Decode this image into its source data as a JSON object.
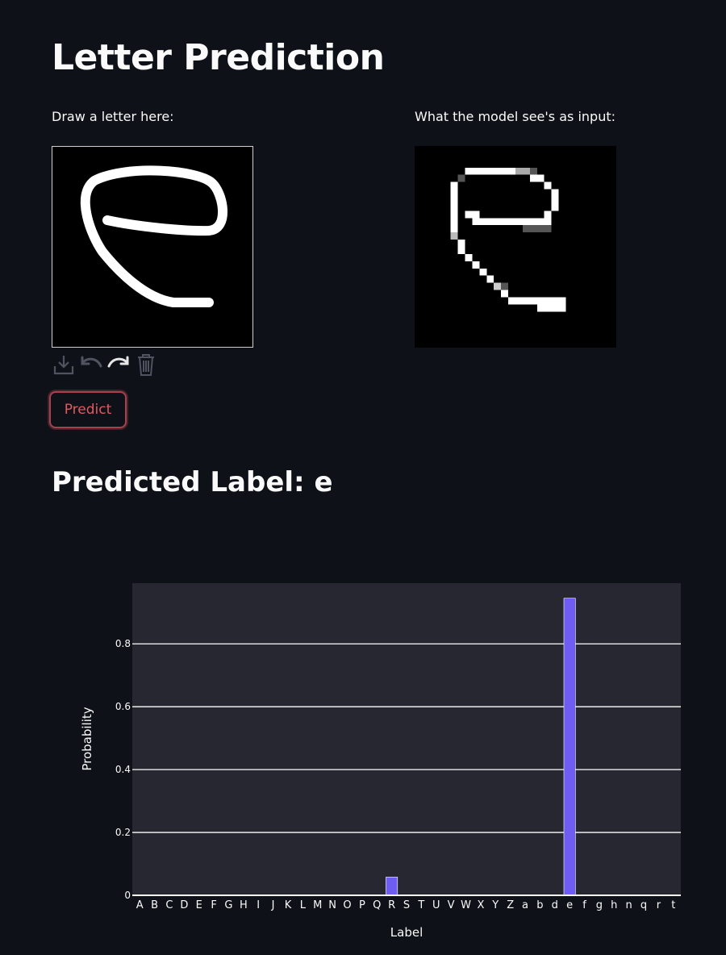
{
  "page": {
    "title": "Letter Prediction",
    "draw_label": "Draw a letter here:",
    "model_label": "What the model see's as input:",
    "predict_button": "Predict",
    "predicted_heading": "Predicted Label: e"
  },
  "toolbar": {
    "icons": [
      "download-icon",
      "undo-icon",
      "redo-icon",
      "trash-icon"
    ]
  },
  "colors": {
    "background": "#0e1117",
    "bar": "#6f5cf3",
    "plot_bg": "#262730",
    "predict_border": "#a8414d",
    "predict_text": "#e05a62"
  },
  "chart_data": {
    "type": "bar",
    "categories": [
      "A",
      "B",
      "C",
      "D",
      "E",
      "F",
      "G",
      "H",
      "I",
      "J",
      "K",
      "L",
      "M",
      "N",
      "O",
      "P",
      "Q",
      "R",
      "S",
      "T",
      "U",
      "V",
      "W",
      "X",
      "Y",
      "Z",
      "a",
      "b",
      "d",
      "e",
      "f",
      "g",
      "h",
      "n",
      "q",
      "r",
      "t"
    ],
    "values": [
      0,
      0,
      0,
      0,
      0,
      0,
      0,
      0,
      0,
      0,
      0,
      0,
      0,
      0,
      0,
      0,
      0,
      0.058,
      0,
      0,
      0,
      0,
      0,
      0,
      0,
      0,
      0,
      0,
      0,
      0.945,
      0,
      0,
      0,
      0,
      0,
      0,
      0
    ],
    "xlabel": "Label",
    "ylabel": "Probability",
    "yticks": [
      0,
      0.2,
      0.4,
      0.6,
      0.8
    ],
    "ytick_labels": [
      "0",
      "0.2",
      "0.4",
      "0.6",
      "0.8"
    ],
    "ylim": [
      0,
      0.993
    ],
    "grid": true
  }
}
